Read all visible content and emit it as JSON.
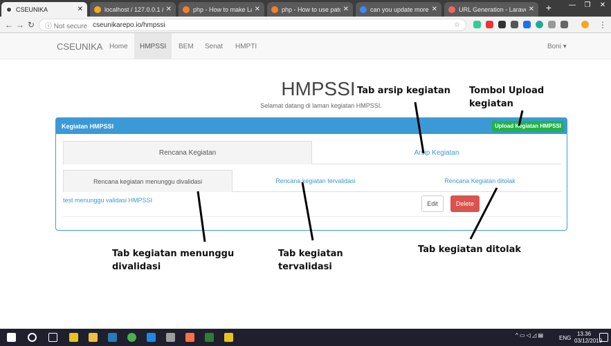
{
  "browser": {
    "tabs": [
      {
        "title": "CSEUNIKA",
        "active": true,
        "color": "#ffffff"
      },
      {
        "title": "localhost / 127.0.0.1 / cs",
        "active": false,
        "color": "#f5a623"
      },
      {
        "title": "php - How to make Lara",
        "active": false,
        "color": "#f48024"
      },
      {
        "title": "php - How to use patch",
        "active": false,
        "color": "#f48024"
      },
      {
        "title": "can you update more th",
        "active": false,
        "color": "#4285f4"
      },
      {
        "title": "URL Generation - Larave",
        "active": false,
        "color": "#f4645f"
      }
    ],
    "new_tab": "+",
    "address": {
      "secure_label": "Not secure",
      "url": "cseunikarepo.io/hmpssi"
    }
  },
  "navbar": {
    "brand": "CSEUNIKA",
    "links": [
      "Home",
      "HMPSSI",
      "BEM",
      "Senat",
      "HMPTI"
    ],
    "active_link": "HMPSSI",
    "user": "Boni ▾"
  },
  "hero": {
    "title": "HMPSSI",
    "subtitle": "Selamat datang di laman kegiatan HMPSSI."
  },
  "panel": {
    "heading": "Kegiatan HMPSSI",
    "upload_button": "Upload Kegiatan HMPSSI",
    "main_tabs": [
      "Rencana Kegiatan",
      "Arsip Kegiatan"
    ],
    "sub_tabs": [
      "Rencana kegiatan menunggu divalidasi",
      "Rencana kegiatan tervalidasi",
      "Rencana Kegiatan ditolak"
    ],
    "rows": [
      {
        "name": "test menunggu validasi HMPSSI",
        "edit": "Edit",
        "delete": "Delete"
      }
    ]
  },
  "annotations": {
    "arsip": "Tab arsip kegiatan",
    "upload": "Tombol Upload kegiatan",
    "menunggu": "Tab kegiatan menunggu divalidasi",
    "tervalidasi": "Tab kegiatan tervalidasi",
    "ditolak": "Tab kegiatan ditolak"
  },
  "taskbar": {
    "lang": "ENG",
    "time": "13.36",
    "date": "03/12/2019"
  },
  "colors": {
    "primary": "#3b9ad6",
    "success": "#22b24c",
    "danger": "#d9534f"
  }
}
